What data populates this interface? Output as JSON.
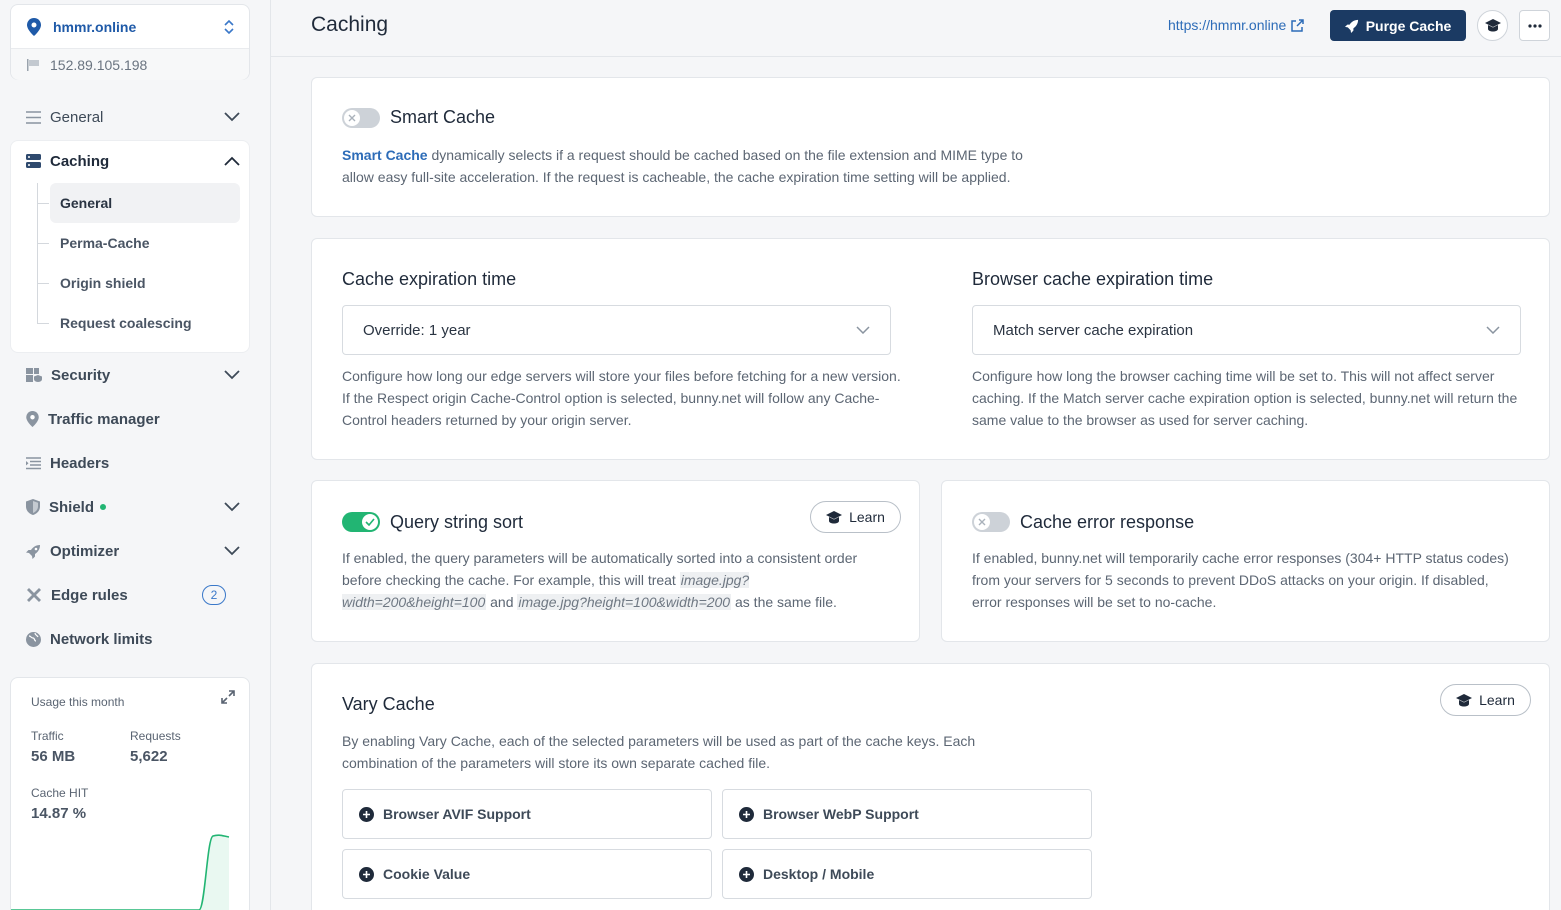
{
  "site": {
    "name": "hmmr.online",
    "ip": "152.89.105.198"
  },
  "sidebar": {
    "items": [
      {
        "label": "General",
        "icon": "menu-lines-icon"
      },
      {
        "label": "Caching",
        "icon": "server-icon"
      },
      {
        "label": "Security",
        "icon": "security-grid-icon"
      },
      {
        "label": "Traffic manager",
        "icon": "map-pin-icon"
      },
      {
        "label": "Headers",
        "icon": "headers-icon"
      },
      {
        "label": "Shield",
        "icon": "shield-icon"
      },
      {
        "label": "Optimizer",
        "icon": "rocket-icon"
      },
      {
        "label": "Edge rules",
        "icon": "tools-icon",
        "badge": "2"
      },
      {
        "label": "Network limits",
        "icon": "globe-icon"
      }
    ],
    "caching_sub": [
      "General",
      "Perma-Cache",
      "Origin shield",
      "Request coalescing"
    ]
  },
  "usage": {
    "title": "Usage this month",
    "traffic_label": "Traffic",
    "traffic_value": "56 MB",
    "requests_label": "Requests",
    "requests_value": "5,622",
    "hit_label": "Cache HIT",
    "hit_value": "14.87 %"
  },
  "header": {
    "title": "Caching",
    "site_url": "https://hmmr.online",
    "purge_label": "Purge Cache"
  },
  "smart_cache": {
    "title": "Smart Cache",
    "enabled": false,
    "link_text": "Smart Cache",
    "desc_line1": " dynamically selects if a request should be cached based on the file extension and MIME type to",
    "desc_line2": "allow easy full-site acceleration. If the request is cacheable, the cache expiration time setting will be applied."
  },
  "cache_expiration": {
    "title": "Cache expiration time",
    "value": "Override: 1 year",
    "desc": "Configure how long our edge servers will store your files before fetching for a new version. If the Respect origin Cache-Control option is selected, bunny.net will follow any Cache-Control headers returned by your origin server."
  },
  "browser_cache": {
    "title": "Browser cache expiration time",
    "value": "Match server cache expiration",
    "desc": "Configure how long the browser caching time will be set to. This will not affect server caching. If the Match server cache expiration option is selected, bunny.net will return the same value to the browser as used for server caching."
  },
  "query_sort": {
    "title": "Query string sort",
    "enabled": true,
    "learn_label": "Learn",
    "desc_a": "If enabled, the query parameters will be automatically sorted into a consistent order before checking the cache. For example, this will treat ",
    "code1": "image.jpg?width=200&height=100",
    "desc_b": " and ",
    "code2": "image.jpg?height=100&width=200",
    "desc_c": " as the same file."
  },
  "error_response": {
    "title": "Cache error response",
    "enabled": false,
    "desc": "If enabled, bunny.net will temporarily cache error responses (304+ HTTP status codes) from your servers for 5 seconds to prevent DDoS attacks on your origin. If disabled, error responses will be set to no-cache."
  },
  "vary_cache": {
    "title": "Vary Cache",
    "learn_label": "Learn",
    "desc": "By enabling Vary Cache, each of the selected parameters will be used as part of the cache keys. Each combination of the parameters will store its own separate cached file.",
    "options": [
      "Browser AVIF Support",
      "Browser WebP Support",
      "Cookie Value",
      "Desktop / Mobile"
    ]
  },
  "colors": {
    "accent": "#1b3a63",
    "link": "#2d6cb8",
    "toggle_on": "#22b573",
    "chart_line": "#22b573"
  }
}
